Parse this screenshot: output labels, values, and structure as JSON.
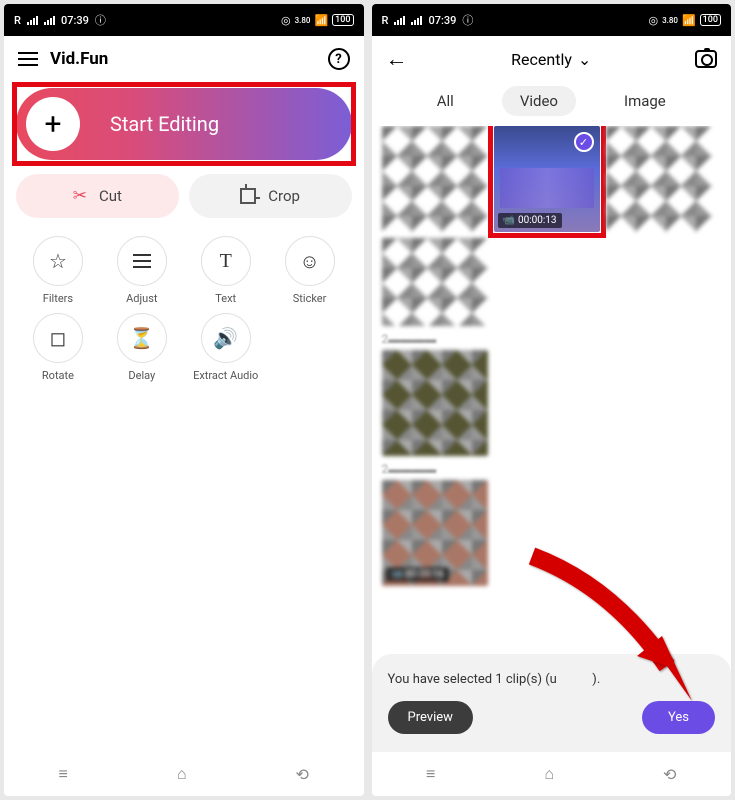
{
  "status": {
    "time": "07:39",
    "net": "3.80",
    "battery": "100"
  },
  "p1": {
    "title": "Vid.Fun",
    "start": "Start Editing",
    "cut": "Cut",
    "crop": "Crop",
    "tools": {
      "filters": "Filters",
      "adjust": "Adjust",
      "text": "Text",
      "sticker": "Sticker",
      "rotate": "Rotate",
      "delay": "Delay",
      "extract": "Extract Audio"
    }
  },
  "p2": {
    "folder": "Recently",
    "tabs": {
      "all": "All",
      "video": "Video",
      "image": "Image"
    },
    "duration": "00:00:13",
    "sheet": "You have selected 1 clip(s) (u",
    "preview": "Preview",
    "yes": "Yes"
  }
}
